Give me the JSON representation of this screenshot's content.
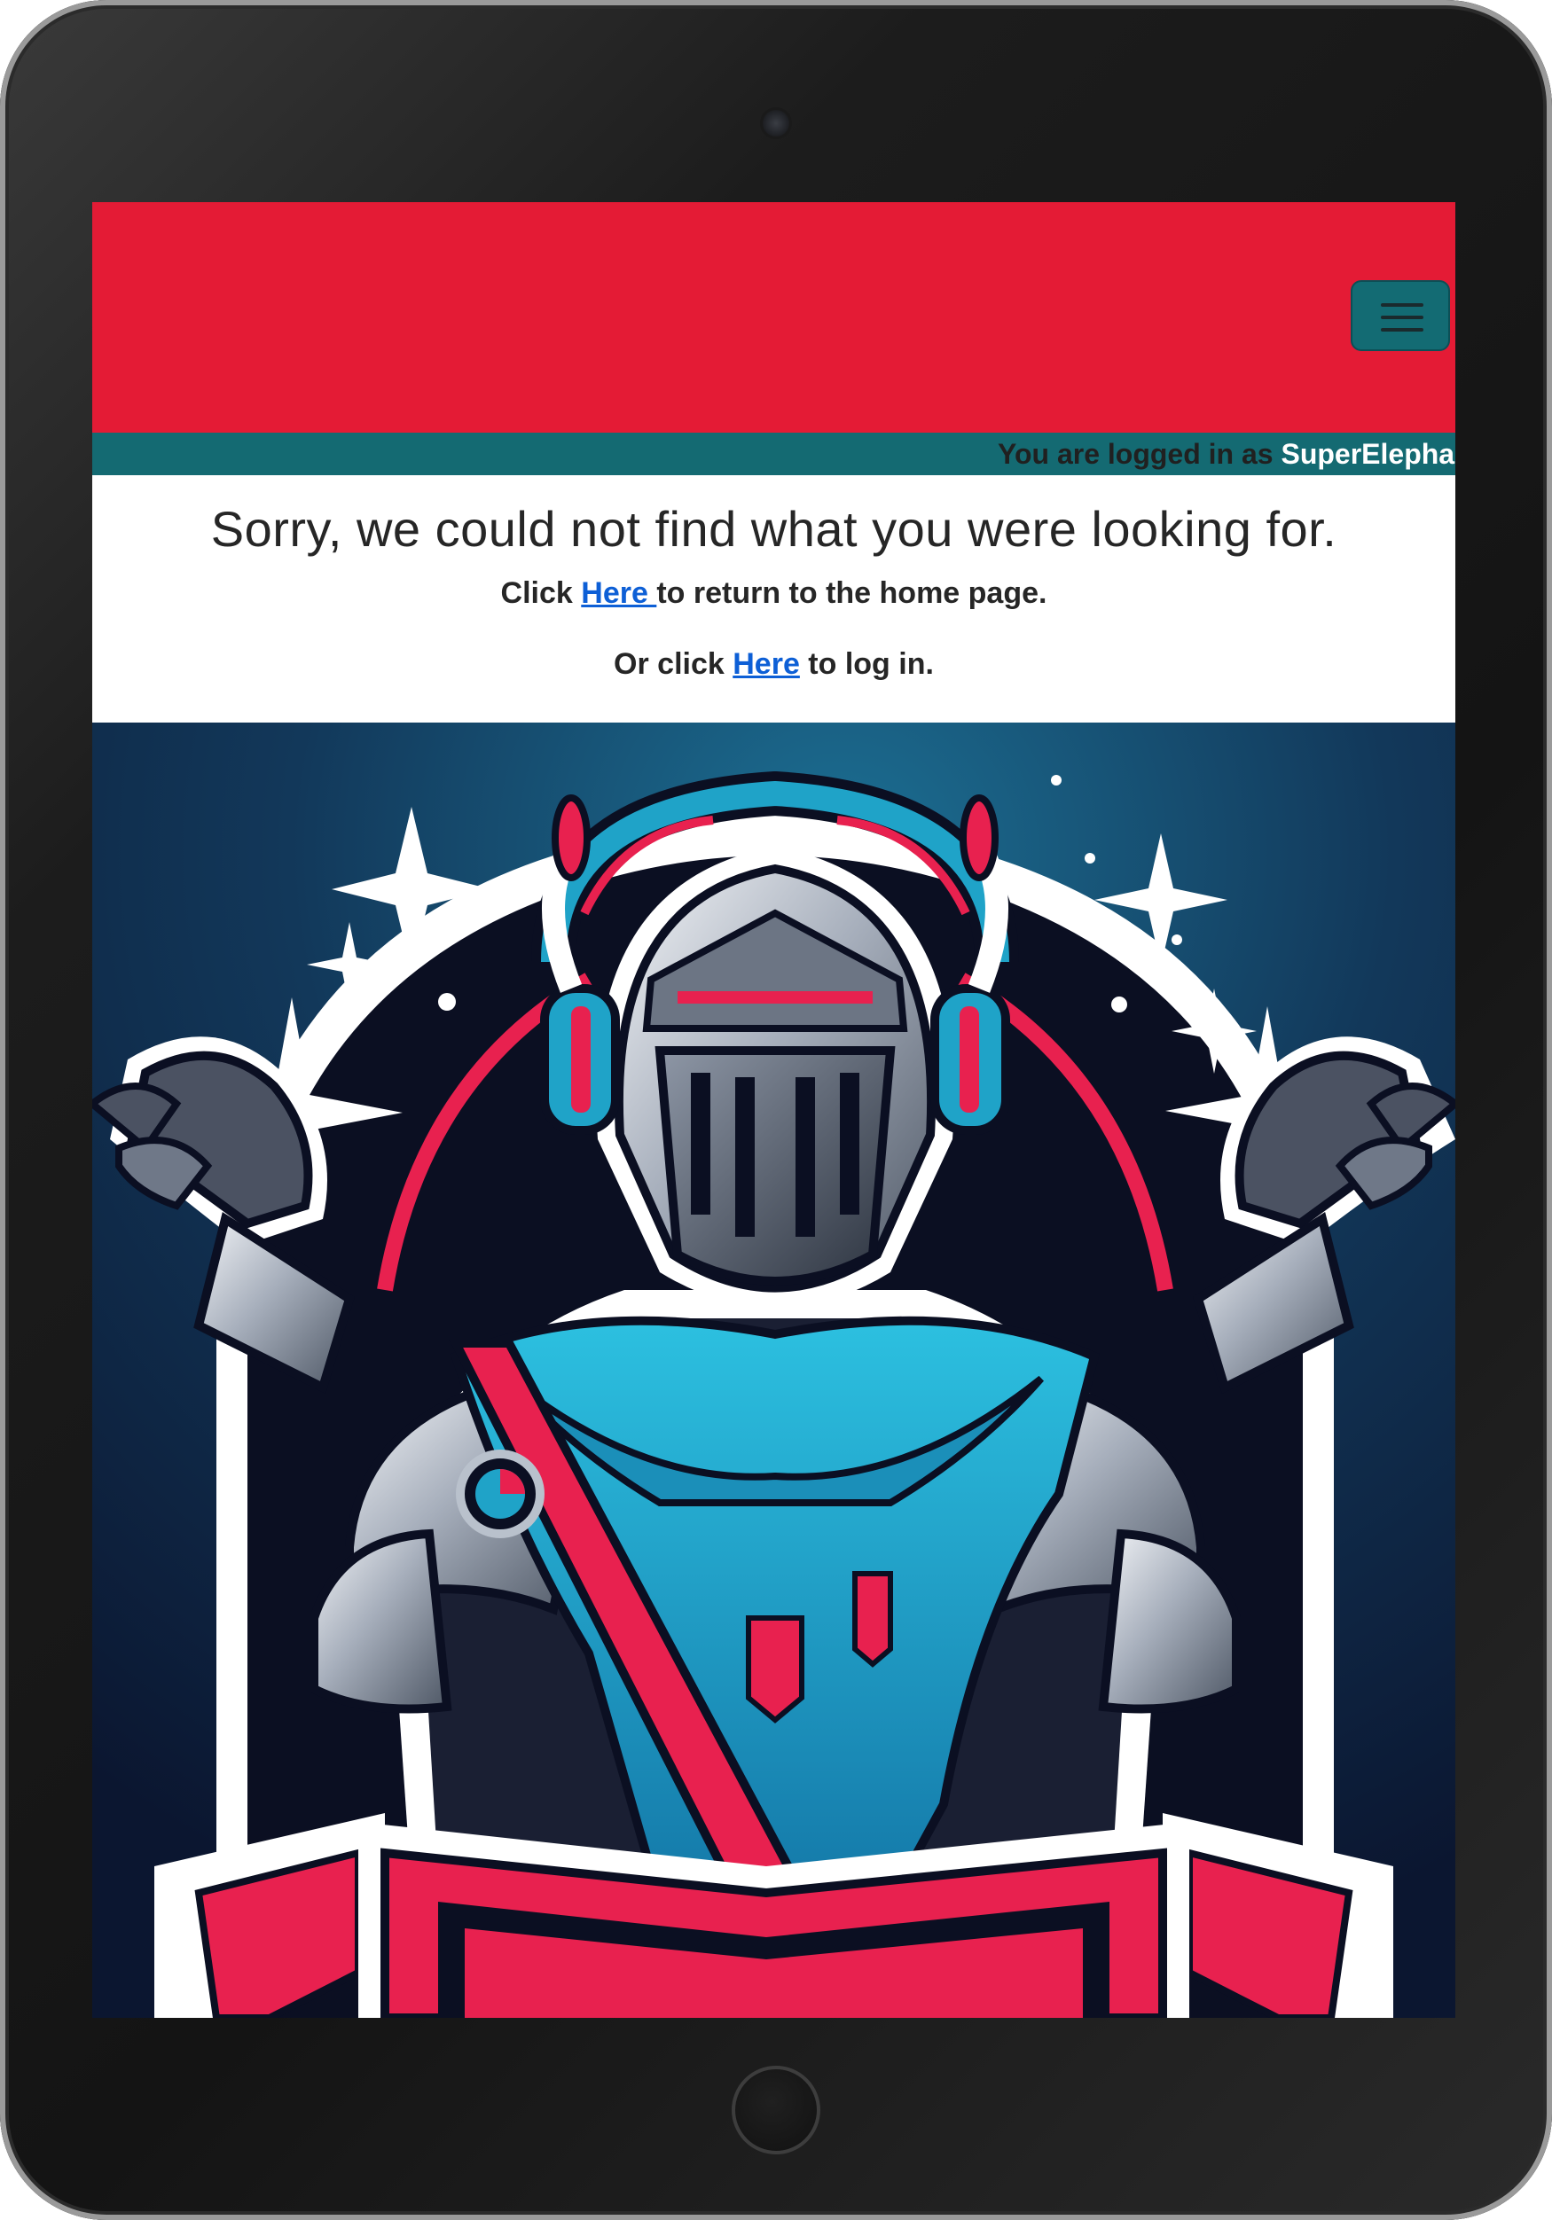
{
  "header": {
    "menu_toggle_icon": "hamburger-menu-icon"
  },
  "login_status": {
    "prefix": "You are logged in as ",
    "username": "SuperElephant"
  },
  "not_found": {
    "title": "Sorry, we could not find what you were looking for.",
    "home_prefix": "Click ",
    "home_link": "Here ",
    "home_suffix": "to return to the home page.",
    "login_prefix": "Or click ",
    "login_link": "Here",
    "login_suffix": " to log in."
  },
  "illustration": {
    "subject": "knight-mascot-shrugging",
    "colors": {
      "brand_red": "#e41b35",
      "brand_teal": "#146a72",
      "link_blue": "#0d5fd6",
      "scarf_cyan": "#1fa3c8",
      "ribbon_pink": "#e8214f",
      "background_navy": "#0f2a47"
    }
  }
}
